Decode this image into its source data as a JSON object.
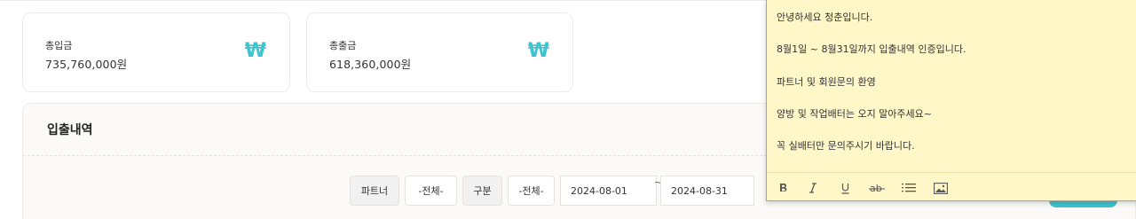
{
  "summary": {
    "income": {
      "label": "총입금",
      "value": "735,760,000원",
      "icon": "won-icon"
    },
    "expense": {
      "label": "총출금",
      "value": "618,360,000원",
      "icon": "won-icon"
    },
    "currency_symbol": "₩",
    "accent_color": "#3ec3d0"
  },
  "history": {
    "title": "입출내역"
  },
  "filters": {
    "partner_label": "파트너",
    "partner_value": "-전체-",
    "type_label": "구분",
    "type_value": "-전체-",
    "date_from": "2024-08-01",
    "date_separator": "~",
    "date_to": "2024-08-31"
  },
  "memo": {
    "lines": [
      "안녕하세요 청춘입니다.",
      "8월1일 ~ 8월31일까지 입출내역 인증입니다.",
      "파트너 및 회원문의 환영",
      "양방 및 작업배터는 오지 말아주세요~",
      "꼭 실배터만 문의주시기 바랍니다."
    ],
    "background_color": "#fff7c8",
    "toolbar": [
      "bold-icon",
      "italic-icon",
      "underline-icon",
      "strikethrough-icon",
      "list-icon",
      "image-icon"
    ]
  }
}
